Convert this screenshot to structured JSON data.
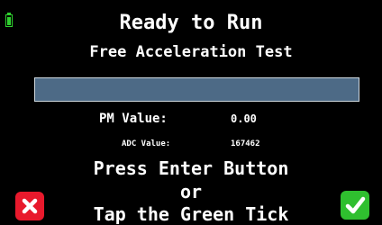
{
  "status": {
    "battery_icon": "battery-icon",
    "battery_color": "#2fd12f"
  },
  "header": {
    "title": "Ready to Run",
    "subtitle": "Free Acceleration Test"
  },
  "progress": {
    "value_fraction": 0.0,
    "track_color": "#4d6a86"
  },
  "readings": {
    "pm_label": "PM Value:",
    "pm_value": "0.00",
    "adc_label": "ADC Value:",
    "adc_value": "167462"
  },
  "instructions": {
    "line1": "Press Enter Button",
    "line2": "or",
    "line3": "Tap the Green Tick"
  },
  "buttons": {
    "cancel_icon": "close-icon",
    "cancel_color": "#e8192c",
    "confirm_icon": "check-icon",
    "confirm_color": "#2fbf2f"
  }
}
